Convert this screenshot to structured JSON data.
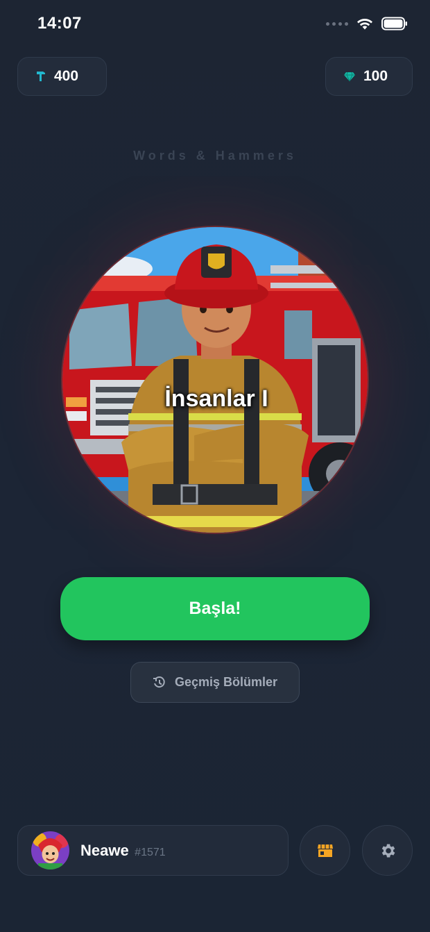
{
  "status_bar": {
    "time": "14:07"
  },
  "currency": {
    "hammers": {
      "icon": "hammer-icon",
      "value": "400",
      "color": "#22b8cf"
    },
    "gems": {
      "icon": "gem-icon",
      "value": "100",
      "color": "#14b8a6"
    }
  },
  "app_title": "Words & Hammers",
  "level": {
    "title": "İnsanlar I"
  },
  "actions": {
    "start_label": "Başla!",
    "history_label": "Geçmiş Bölümler",
    "accent": "#22c55e"
  },
  "profile": {
    "name": "Neawe",
    "tag": "#1571"
  },
  "bottom_icons": {
    "shop": "shop-icon",
    "settings": "gear-icon"
  }
}
